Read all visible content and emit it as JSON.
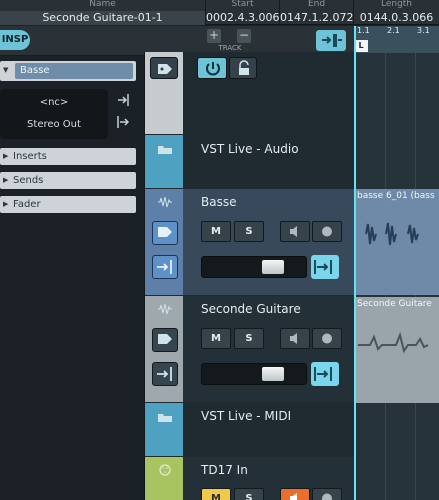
{
  "infoline": {
    "name_header": "Name",
    "name_value": "Seconde Guitare-01-1",
    "start_header": "Start",
    "start_value": "0002.4.3.006",
    "end_header": "End",
    "end_value": "0147.1.2.072",
    "length_header": "Length",
    "length_value": "0144.0.3.066"
  },
  "toolbar": {
    "insp_label": "INSP",
    "add_track_symbol": "+",
    "remove_track_symbol": "−",
    "track_label": "TRACK"
  },
  "inspector": {
    "track_name": "Basse",
    "input_routing": "<nc>",
    "output_routing": "Stereo Out",
    "sections": [
      "Inserts",
      "Sends",
      "Fader"
    ]
  },
  "tracks": [
    {
      "name": "VST Live - Audio",
      "type": "folder"
    },
    {
      "name": "Basse",
      "type": "audio",
      "mute": "M",
      "solo": "S",
      "selected": true
    },
    {
      "name": "Seconde Guitare",
      "type": "audio",
      "mute": "M",
      "solo": "S"
    },
    {
      "name": "VST Live - MIDI",
      "type": "folder"
    },
    {
      "name": "TD17 In",
      "type": "midi",
      "mute": "M",
      "solo": "S"
    }
  ],
  "arrange": {
    "ruler_ticks": [
      "1.1",
      "2.1",
      "3.1"
    ],
    "locator_label": "L",
    "events": [
      "basse 6_01 (bass",
      "Seconde Guitare"
    ]
  },
  "colors": {
    "accent": "#6ec3d7",
    "selected_track": "#5d91c8",
    "mute_active": "#f0c94a",
    "record_active": "#ea6e2c",
    "cursor": "#69e1f5"
  }
}
